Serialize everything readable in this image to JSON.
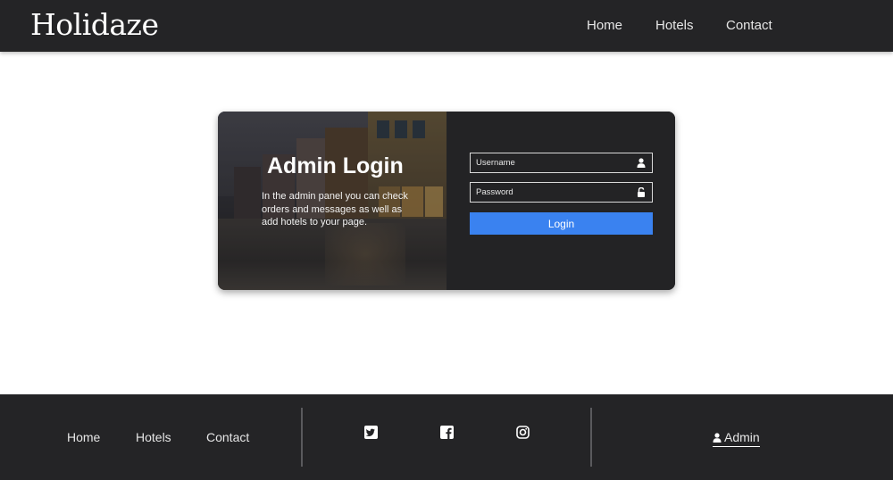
{
  "header": {
    "logo": "Holidaze",
    "nav": [
      {
        "label": "Home"
      },
      {
        "label": "Hotels"
      },
      {
        "label": "Contact"
      }
    ]
  },
  "login_card": {
    "title": "Admin Login",
    "description": "In the admin panel you can check orders and messages as well as add hotels to your page.",
    "username": {
      "placeholder": "Username",
      "value": "",
      "icon": "user-icon"
    },
    "password": {
      "placeholder": "Password",
      "value": "",
      "icon": "lock-icon"
    },
    "login_button": "Login",
    "button_color": "#3a82f0"
  },
  "footer": {
    "nav": [
      {
        "label": "Home"
      },
      {
        "label": "Hotels"
      },
      {
        "label": "Contact"
      }
    ],
    "social": [
      "twitter-icon",
      "facebook-icon",
      "instagram-icon"
    ],
    "admin_link": "Admin"
  },
  "colors": {
    "dark_bg": "#242426",
    "card_bg": "#232325",
    "accent": "#3a82f0"
  }
}
